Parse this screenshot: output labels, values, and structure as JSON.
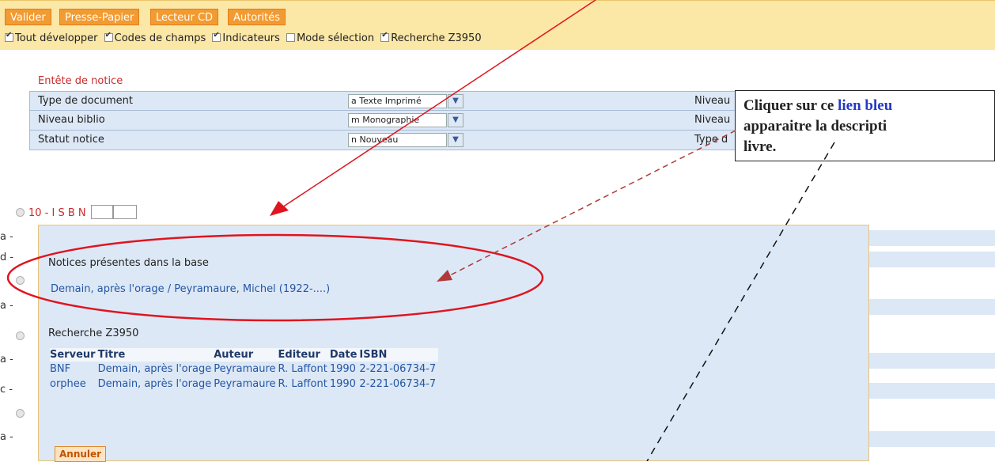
{
  "toolbar": {
    "buttons": [
      "Valider",
      "Presse-Papier",
      "Lecteur CD",
      "Autorités"
    ],
    "checkboxes": [
      {
        "label": "Tout développer",
        "checked": true
      },
      {
        "label": "Codes de champs",
        "checked": true
      },
      {
        "label": "Indicateurs",
        "checked": true
      },
      {
        "label": "Mode sélection",
        "checked": false
      },
      {
        "label": "Recherche Z3950",
        "checked": true
      }
    ]
  },
  "entete": {
    "title": "Entête de notice",
    "rows": [
      {
        "label": "Type de document",
        "value": "a  Texte Imprimé",
        "right_label": "Niveau"
      },
      {
        "label": "Niveau biblio",
        "value": "m  Monographie",
        "right_label": "Niveau"
      },
      {
        "label": "Statut notice",
        "value": "n  Nouveau",
        "right_label": "Type d"
      }
    ]
  },
  "isbn": {
    "label": "10 - I S B N"
  },
  "left_column": [
    "a -",
    "d -",
    "",
    "a -",
    "",
    "a -",
    "c -",
    "",
    "a -"
  ],
  "popup": {
    "notices_title": "Notices présentes dans la base",
    "notice_link": "Demain, après l'orage / Peyramaure, Michel (1922-....)",
    "z3950_title": "Recherche Z3950",
    "columns": [
      "Serveur",
      "Titre",
      "Auteur",
      "Editeur",
      "Date",
      "ISBN"
    ],
    "rows": [
      [
        "BNF",
        "Demain, après l'orage",
        "Peyramaure",
        "R. Laffont",
        "1990",
        "2-221-06734-7"
      ],
      [
        "orphee",
        "Demain, après l'orage",
        "Peyramaure",
        "R. Laffont",
        "1990",
        "2-221-06734-7"
      ]
    ],
    "cancel_label": "Annuler"
  },
  "callout": {
    "line1_prefix": "Cliquer sur ce ",
    "line1_link": "lien bleu",
    "line2": "apparaitre la  descripti",
    "line3": "livre."
  },
  "colors": {
    "accent": "#f29b32",
    "link": "#2456a4",
    "panel": "#dde8f6",
    "arrow": "#e0141e"
  }
}
